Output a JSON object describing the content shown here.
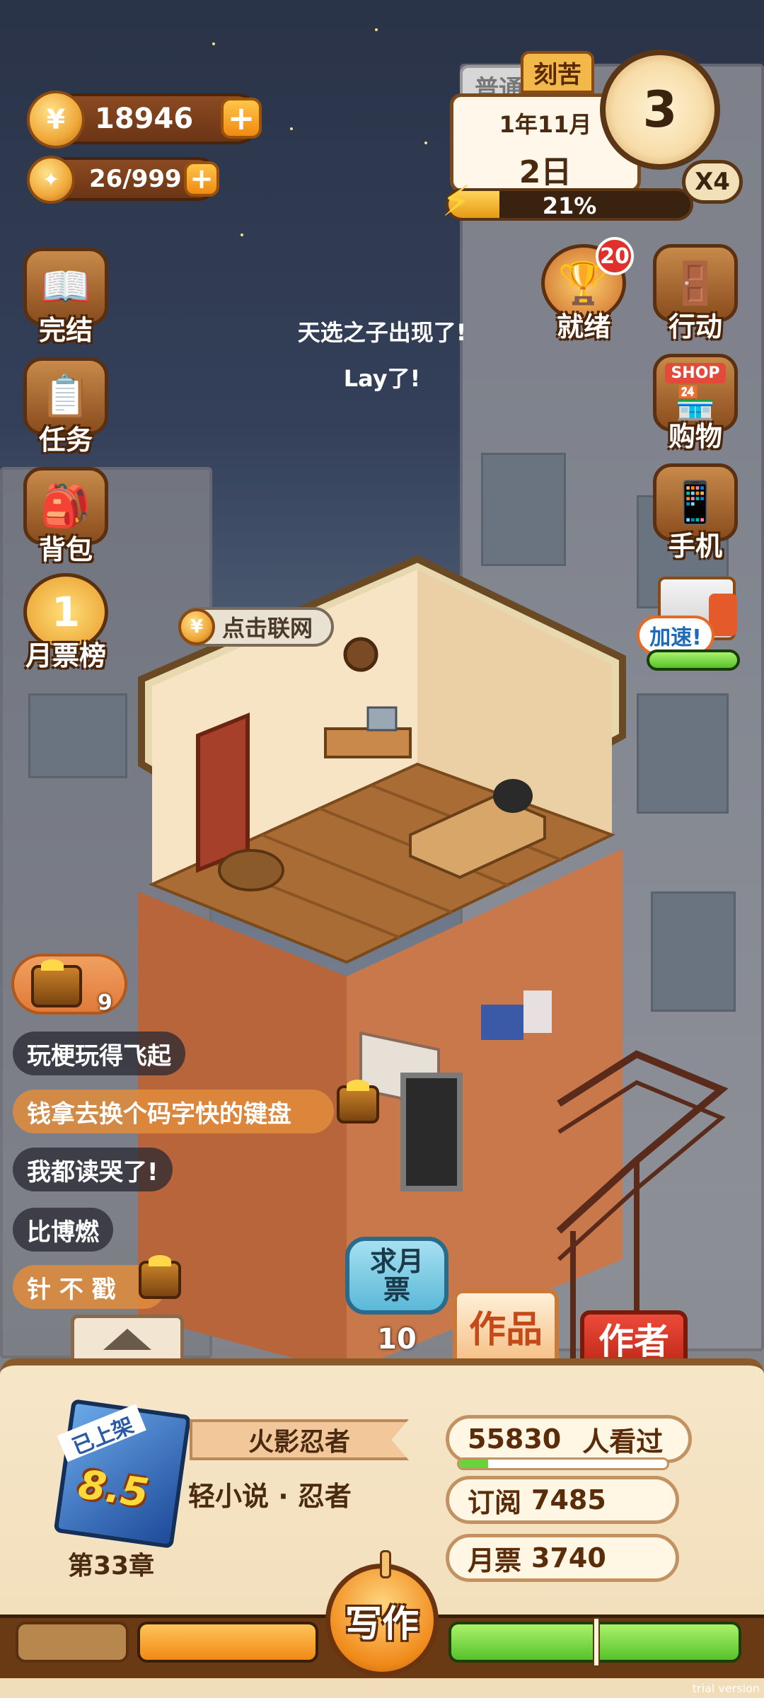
{
  "hud": {
    "coins": "18946",
    "energy_count": "26/999",
    "plus": "+",
    "tab_normal": "普通",
    "tab_hard": "刻苦",
    "date_year_month": "1年11月",
    "date_day": "2日",
    "clock_value": "3",
    "speed_multiplier": "X4",
    "energy_percent": "21%",
    "energy_fill": 0.21
  },
  "left_menu": [
    {
      "label": "完结",
      "icon": "book-icon"
    },
    {
      "label": "任务",
      "icon": "checklist-icon"
    },
    {
      "label": "背包",
      "icon": "backpack-icon"
    },
    {
      "label": "月票榜",
      "icon": "medal-icon",
      "medal_text": "1"
    }
  ],
  "right_menu": [
    {
      "label": "就绪",
      "icon": "trophy-icon",
      "badge": "20"
    },
    {
      "label": "行动",
      "icon": "door-icon"
    },
    {
      "label": "购物",
      "icon": "shop-icon",
      "sign": "SHOP"
    },
    {
      "label": "手机",
      "icon": "phone-icon"
    }
  ],
  "speedup": {
    "label": "加速!"
  },
  "announcement": {
    "line1": "天选之子出现了!",
    "line2": "Lay了!"
  },
  "network_button": "点击联网",
  "chest_count": "9",
  "chat": [
    "玩梗玩得飞起",
    "钱拿去换个码字快的键盘",
    "我都读哭了!",
    "比博燃",
    "针 不 戳"
  ],
  "vote": {
    "label": "求月票",
    "count": "10"
  },
  "tabs": {
    "works": "作品",
    "author": "作者"
  },
  "book": {
    "status": "已上架",
    "score": "8.5",
    "title": "火影忍者",
    "genre": "轻小说 · 忍者",
    "chapter": "第33章",
    "views": "55830",
    "views_label": "人看过",
    "views_fill": 0.14,
    "subscriptions_label": "订阅",
    "subscriptions": "7485",
    "monthly_votes_label": "月票",
    "monthly_votes": "3740"
  },
  "write_button": "写作",
  "watermark": "trial version"
}
